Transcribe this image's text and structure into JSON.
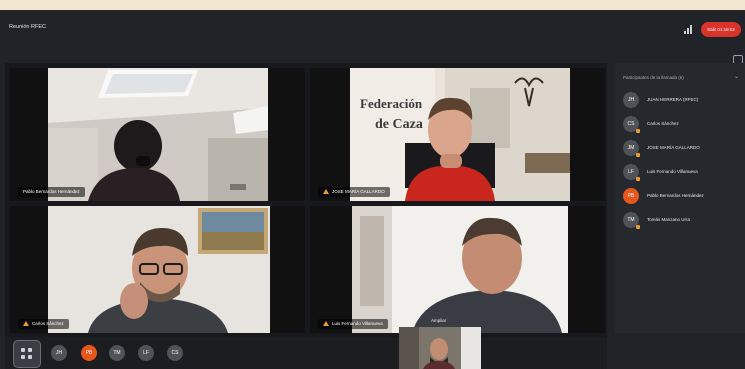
{
  "window": {
    "title": "Reunión RFEC"
  },
  "header": {
    "leave_label": "Salir 01:18:02"
  },
  "tiles": [
    {
      "name": "Pablo Bernardos Hernández"
    },
    {
      "name": "JOSE MARÍA GALLARDO"
    },
    {
      "name": "Carlos Sánchez"
    },
    {
      "name": "Luis Fernando Villanueva"
    }
  ],
  "wall_sign": {
    "line1": "Federación",
    "line2": "de Caza"
  },
  "sidebar": {
    "title": "Participantes de la llamada (6)",
    "participants": [
      {
        "initials": "JH",
        "name": "JUAN HERRERA (RFEC)",
        "color": "#4f5358"
      },
      {
        "initials": "CS",
        "name": "Carlos Sánchez",
        "color": "#4f5358"
      },
      {
        "initials": "JM",
        "name": "JOSE MARÍA GALLARDO",
        "color": "#4f5358"
      },
      {
        "initials": "LF",
        "name": "Luis Fernando Villanueva",
        "color": "#4f5358"
      },
      {
        "initials": "PB",
        "name": "Pablo Bernardos Hernández",
        "color": "#e8561c"
      },
      {
        "initials": "TM",
        "name": "Tomás Manzano Urra",
        "color": "#4f5358"
      }
    ]
  },
  "bottom_bar": {
    "avatars": [
      {
        "initials": "JH"
      },
      {
        "initials": "PB"
      },
      {
        "initials": "TM"
      },
      {
        "initials": "LF"
      },
      {
        "initials": "CS"
      }
    ],
    "tooltip": "Ampliar"
  }
}
